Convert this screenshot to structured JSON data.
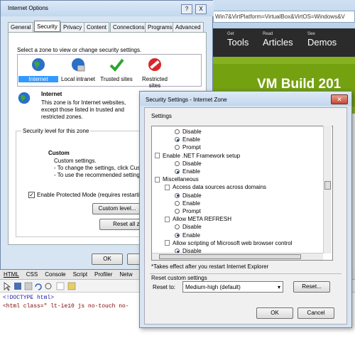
{
  "browser": {
    "address": "Win7&VirtPlatform=VirtualBox&VirtOS=Windows&V",
    "nav": [
      {
        "small": "Get",
        "big": "Tools"
      },
      {
        "small": "Read",
        "big": "Articles"
      },
      {
        "small": "See",
        "big": "Demos"
      }
    ],
    "headline": "VM Build 201"
  },
  "internet_options": {
    "title": "Internet Options",
    "help_btn": "?",
    "close_btn": "X",
    "tabs": [
      "General",
      "Security",
      "Privacy",
      "Content",
      "Connections",
      "Programs",
      "Advanced"
    ],
    "zone_prompt": "Select a zone to view or change security settings.",
    "zones": [
      {
        "label": "Internet",
        "icon": "globe-icon"
      },
      {
        "label": "Local intranet",
        "icon": "intranet-icon"
      },
      {
        "label": "Trusted sites",
        "icon": "checkmark-icon"
      },
      {
        "label": "Restricted sites",
        "icon": "restricted-icon"
      }
    ],
    "zone_name": "Internet",
    "zone_desc": "This zone is for Internet websites, except those listed in trusted and restricted zones.",
    "level_group": "Security level for this zone",
    "custom_title": "Custom",
    "custom_lines": [
      "Custom settings.",
      "- To change the settings, click Custom",
      "- To use the recommended settings"
    ],
    "protected_mode": "Enable Protected Mode (requires restarting",
    "custom_level_btn": "Custom level...",
    "reset_all_btn": "Reset all zo",
    "ok": "OK",
    "cancel": "C"
  },
  "security_settings": {
    "title": "Security Settings - Internet Zone",
    "settings_label": "Settings",
    "items": [
      {
        "type": "radio",
        "label": "Disable",
        "checked": false,
        "indent": 2
      },
      {
        "type": "radio",
        "label": "Enable",
        "checked": true,
        "indent": 2
      },
      {
        "type": "radio",
        "label": "Prompt",
        "checked": false,
        "indent": 2
      },
      {
        "type": "section",
        "label": "Enable .NET Framework setup",
        "indent": 0
      },
      {
        "type": "radio",
        "label": "Disable",
        "checked": false,
        "indent": 2
      },
      {
        "type": "radio",
        "label": "Enable",
        "checked": true,
        "indent": 2
      },
      {
        "type": "section",
        "label": "Miscellaneous",
        "indent": 0
      },
      {
        "type": "doc",
        "label": "Access data sources across domains",
        "indent": 1
      },
      {
        "type": "radio",
        "label": "Disable",
        "checked": true,
        "indent": 2
      },
      {
        "type": "radio",
        "label": "Enable",
        "checked": false,
        "indent": 2
      },
      {
        "type": "radio",
        "label": "Prompt",
        "checked": false,
        "indent": 2
      },
      {
        "type": "doc",
        "label": "Allow META REFRESH",
        "indent": 1
      },
      {
        "type": "radio",
        "label": "Disable",
        "checked": false,
        "indent": 2
      },
      {
        "type": "radio",
        "label": "Enable",
        "checked": true,
        "indent": 2
      },
      {
        "type": "doc",
        "label": "Allow scripting of Microsoft web browser control",
        "indent": 1
      },
      {
        "type": "radio",
        "label": "Disable",
        "checked": true,
        "indent": 2
      }
    ],
    "note": "*Takes effect after you restart Internet Explorer",
    "reset_group": "Reset custom settings",
    "reset_to_label": "Reset to:",
    "reset_value": "Medium-high (default)",
    "reset_btn": "Reset...",
    "ok": "OK",
    "cancel": "Cancel"
  },
  "devtools": {
    "tabs": [
      "HTML",
      "CSS",
      "Console",
      "Script",
      "Profiler",
      "Netw"
    ],
    "lines": [
      "<!DOCTYPE html>",
      "<html class=\" lt-ie10 js no-touch no-"
    ]
  }
}
